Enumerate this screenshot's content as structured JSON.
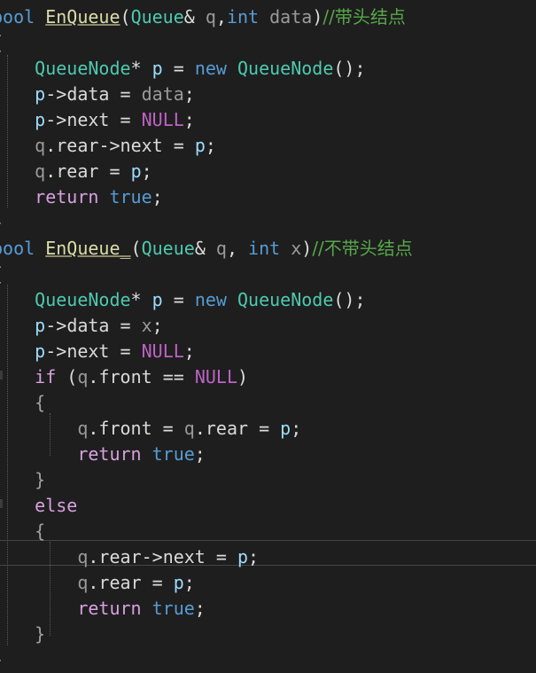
{
  "editor": {
    "colors": {
      "background": "#1e1e1e",
      "keyword": "#569cd6",
      "control_keyword": "#d8a0df",
      "type": "#4ec9b0",
      "function": "#dcdcaa",
      "parameter": "#9a9a9a",
      "variable": "#9cdcfe",
      "macro": "#bd63c5",
      "comment": "#57a64a"
    },
    "lines": [
      [
        [
          "kw",
          "bool"
        ],
        [
          "p",
          " "
        ],
        [
          "fn",
          "EnQueue"
        ],
        [
          "p",
          "("
        ],
        [
          "type",
          "Queue"
        ],
        [
          "p",
          "& "
        ],
        [
          "param",
          "q"
        ],
        [
          "p",
          ","
        ],
        [
          "kw",
          "int"
        ],
        [
          "p",
          " "
        ],
        [
          "param",
          "data"
        ],
        [
          "p",
          ")"
        ],
        [
          "comment",
          "//带头结点"
        ]
      ],
      [
        [
          "brace",
          "{"
        ]
      ],
      [
        [
          "p",
          "    "
        ],
        [
          "type",
          "QueueNode"
        ],
        [
          "p",
          "* "
        ],
        [
          "var",
          "p"
        ],
        [
          "p",
          " = "
        ],
        [
          "kw",
          "new"
        ],
        [
          "p",
          " "
        ],
        [
          "type",
          "QueueNode"
        ],
        [
          "p",
          "();"
        ]
      ],
      [
        [
          "p",
          "    "
        ],
        [
          "var",
          "p"
        ],
        [
          "p",
          "->"
        ],
        [
          "member",
          "data"
        ],
        [
          "p",
          " = "
        ],
        [
          "param",
          "data"
        ],
        [
          "p",
          ";"
        ]
      ],
      [
        [
          "p",
          "    "
        ],
        [
          "var",
          "p"
        ],
        [
          "p",
          "->"
        ],
        [
          "member",
          "next"
        ],
        [
          "p",
          " = "
        ],
        [
          "macro",
          "NULL"
        ],
        [
          "p",
          ";"
        ]
      ],
      [
        [
          "p",
          "    "
        ],
        [
          "param",
          "q"
        ],
        [
          "p",
          "."
        ],
        [
          "member",
          "rear"
        ],
        [
          "p",
          "->"
        ],
        [
          "member",
          "next"
        ],
        [
          "p",
          " = "
        ],
        [
          "var",
          "p"
        ],
        [
          "p",
          ";"
        ]
      ],
      [
        [
          "p",
          "    "
        ],
        [
          "param",
          "q"
        ],
        [
          "p",
          "."
        ],
        [
          "member",
          "rear"
        ],
        [
          "p",
          " = "
        ],
        [
          "var",
          "p"
        ],
        [
          "p",
          ";"
        ]
      ],
      [
        [
          "p",
          "    "
        ],
        [
          "flow",
          "return"
        ],
        [
          "p",
          " "
        ],
        [
          "kw",
          "true"
        ],
        [
          "p",
          ";"
        ]
      ],
      [
        [
          "brace",
          "}"
        ]
      ],
      [
        [
          "kw",
          "bool"
        ],
        [
          "p",
          " "
        ],
        [
          "fn",
          "EnQueue_"
        ],
        [
          "p",
          "("
        ],
        [
          "type",
          "Queue"
        ],
        [
          "p",
          "& "
        ],
        [
          "param",
          "q"
        ],
        [
          "p",
          ", "
        ],
        [
          "kw",
          "int"
        ],
        [
          "p",
          " "
        ],
        [
          "param",
          "x"
        ],
        [
          "p",
          ")"
        ],
        [
          "comment",
          "//不带头结点"
        ]
      ],
      [
        [
          "brace",
          "{"
        ]
      ],
      [
        [
          "p",
          "    "
        ],
        [
          "type",
          "QueueNode"
        ],
        [
          "p",
          "* "
        ],
        [
          "var",
          "p"
        ],
        [
          "p",
          " = "
        ],
        [
          "kw",
          "new"
        ],
        [
          "p",
          " "
        ],
        [
          "type",
          "QueueNode"
        ],
        [
          "p",
          "();"
        ]
      ],
      [
        [
          "p",
          "    "
        ],
        [
          "var",
          "p"
        ],
        [
          "p",
          "->"
        ],
        [
          "member",
          "data"
        ],
        [
          "p",
          " = "
        ],
        [
          "param",
          "x"
        ],
        [
          "p",
          ";"
        ]
      ],
      [
        [
          "p",
          "    "
        ],
        [
          "var",
          "p"
        ],
        [
          "p",
          "->"
        ],
        [
          "member",
          "next"
        ],
        [
          "p",
          " = "
        ],
        [
          "macro",
          "NULL"
        ],
        [
          "p",
          ";"
        ]
      ],
      [
        [
          "p",
          "    "
        ],
        [
          "flow",
          "if"
        ],
        [
          "p",
          " ("
        ],
        [
          "param",
          "q"
        ],
        [
          "p",
          "."
        ],
        [
          "member",
          "front"
        ],
        [
          "p",
          " == "
        ],
        [
          "macro",
          "NULL"
        ],
        [
          "p",
          ")"
        ]
      ],
      [
        [
          "p",
          "    "
        ],
        [
          "brace",
          "{"
        ]
      ],
      [
        [
          "p",
          "        "
        ],
        [
          "param",
          "q"
        ],
        [
          "p",
          "."
        ],
        [
          "member",
          "front"
        ],
        [
          "p",
          " = "
        ],
        [
          "param",
          "q"
        ],
        [
          "p",
          "."
        ],
        [
          "member",
          "rear"
        ],
        [
          "p",
          " = "
        ],
        [
          "var",
          "p"
        ],
        [
          "p",
          ";"
        ]
      ],
      [
        [
          "p",
          "        "
        ],
        [
          "flow",
          "return"
        ],
        [
          "p",
          " "
        ],
        [
          "kw",
          "true"
        ],
        [
          "p",
          ";"
        ]
      ],
      [
        [
          "p",
          "    "
        ],
        [
          "brace",
          "}"
        ]
      ],
      [
        [
          "p",
          "    "
        ],
        [
          "flow",
          "else"
        ]
      ],
      [
        [
          "p",
          "    "
        ],
        [
          "brace",
          "{"
        ]
      ],
      [
        [
          "p",
          "        "
        ],
        [
          "param",
          "q"
        ],
        [
          "p",
          "."
        ],
        [
          "member",
          "rear"
        ],
        [
          "p",
          "->"
        ],
        [
          "member",
          "next"
        ],
        [
          "p",
          " = "
        ],
        [
          "var",
          "p"
        ],
        [
          "p",
          ";"
        ]
      ],
      [
        [
          "p",
          "        "
        ],
        [
          "param",
          "q"
        ],
        [
          "p",
          "."
        ],
        [
          "member",
          "rear"
        ],
        [
          "p",
          " = "
        ],
        [
          "var",
          "p"
        ],
        [
          "p",
          ";"
        ]
      ],
      [
        [
          "p",
          "        "
        ],
        [
          "flow",
          "return"
        ],
        [
          "p",
          " "
        ],
        [
          "kw",
          "true"
        ],
        [
          "p",
          ";"
        ]
      ],
      [
        [
          "p",
          "    "
        ],
        [
          "brace",
          "}"
        ]
      ],
      [
        [
          "brace",
          "}"
        ]
      ]
    ]
  }
}
